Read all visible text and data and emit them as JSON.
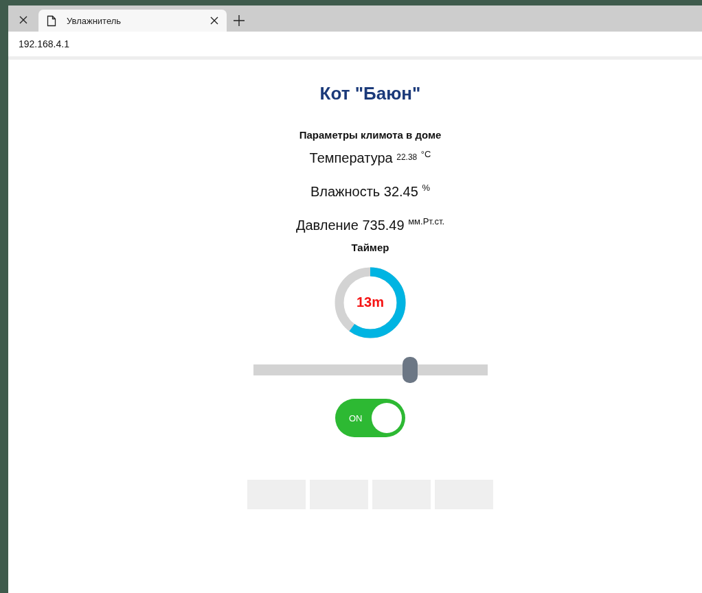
{
  "browser": {
    "tabs": [
      {
        "selected": false
      },
      {
        "title": "Увлажнитель",
        "selected": true
      }
    ],
    "address": "192.168.4.1"
  },
  "page": {
    "title": "Кот \"Баюн\"",
    "section_title": "Параметры климота в доме",
    "readings": [
      {
        "label": "Температура",
        "value": "22.38",
        "unit": "°C",
        "kind": "small"
      },
      {
        "label": "Влажность",
        "value": "32.45",
        "unit": "%",
        "kind": "normal"
      },
      {
        "label": "Давление",
        "value": "735.49",
        "unit": "мм.Рт.ст.",
        "kind": "normal"
      }
    ],
    "timer": {
      "title": "Таймер",
      "text": "13m",
      "level": 0.6
    },
    "slider": {
      "level": 0.67
    },
    "switch": {
      "label": "ON",
      "on": true
    }
  }
}
